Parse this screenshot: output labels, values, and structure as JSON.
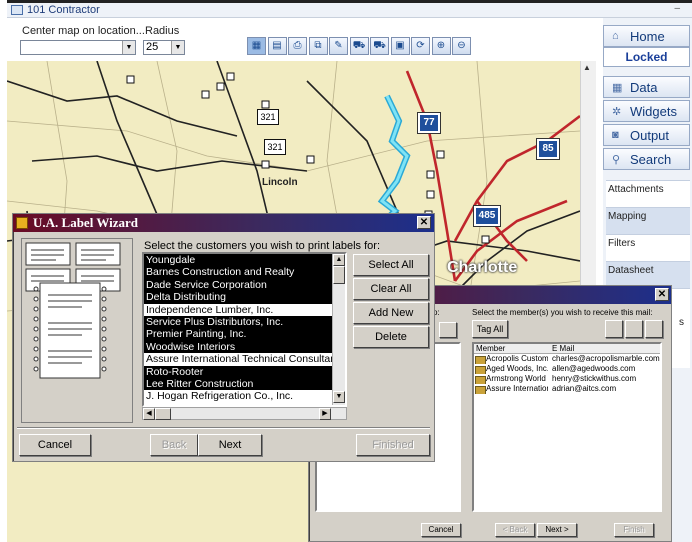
{
  "window": {
    "title": "101 Contractor",
    "min_glyph": "–"
  },
  "topbar": {
    "center_label": "Center map on location...",
    "center_value": "",
    "radius_label": "Radius",
    "radius_value": "25",
    "toolbar_icons": [
      "map-view-icon",
      "layers-icon",
      "print-icon",
      "copy-icon",
      "edit-icon",
      "car-icon",
      "truck-icon",
      "bus-icon",
      "route-icon",
      "zoom-in-icon",
      "zoom-out-icon"
    ]
  },
  "map": {
    "places": [
      "Lincoln",
      "Charlotte"
    ],
    "highways": [
      "321",
      "321",
      "77",
      "85",
      "485",
      "77"
    ]
  },
  "sidebar": {
    "nav": [
      {
        "label": "Home",
        "icon": "home-icon"
      },
      {
        "label": "Data",
        "icon": "table-icon"
      },
      {
        "label": "Widgets",
        "icon": "widgets-icon"
      },
      {
        "label": "Output",
        "icon": "output-icon"
      },
      {
        "label": "Search",
        "icon": "search-icon"
      }
    ],
    "locked": "Locked",
    "tabs": [
      "Attachments",
      "Mapping",
      "Filters",
      "Datasheet",
      "s"
    ]
  },
  "label_wizard": {
    "title": "U.A. Label Wizard",
    "prompt": "Select the customers you wish to print labels for:",
    "customers": [
      {
        "name": "Youngdale",
        "selected": true
      },
      {
        "name": "Barnes Construction and Realty",
        "selected": true
      },
      {
        "name": "Dade Service Corporation",
        "selected": true
      },
      {
        "name": "Delta Distributing",
        "selected": true
      },
      {
        "name": "Independence Lumber, Inc.",
        "selected": false
      },
      {
        "name": "Service Plus Distributors, Inc.",
        "selected": true
      },
      {
        "name": "Premier Painting, Inc.",
        "selected": true
      },
      {
        "name": "Woodwise Interiors",
        "selected": true
      },
      {
        "name": "Assure International Technical Consultants",
        "selected": false
      },
      {
        "name": "Roto-Rooter",
        "selected": true
      },
      {
        "name": "Lee Ritter Construction",
        "selected": true
      },
      {
        "name": "J. Hogan Refrigeration Co., Inc.",
        "selected": false
      }
    ],
    "buttons": {
      "select_all": "Select All",
      "clear_all": "Clear All",
      "add_new": "Add New",
      "delete": "Delete"
    },
    "footer": {
      "cancel": "Cancel",
      "back": "Back",
      "next": "Next",
      "finished": "Finished"
    }
  },
  "mail_dialog": {
    "prompt": "Select the member(s) you wish to receive this mail:",
    "left_label": "o:",
    "tag_all": "Tag All",
    "columns": {
      "member": "Member",
      "email": "E Mail"
    },
    "members": [
      {
        "member": "Acropolis Custom Mar...",
        "email": "charles@acropolismarble.com"
      },
      {
        "member": "Aged Woods, Inc.",
        "email": "allen@agedwoods.com"
      },
      {
        "member": "Armstrong World Indu...",
        "email": "henry@stickwithus.com"
      },
      {
        "member": "Assure International ...",
        "email": "adrian@aitcs.com"
      }
    ],
    "footer": {
      "cancel": "Cancel",
      "back": "< Back",
      "next": "Next >",
      "finish": "Finish"
    }
  }
}
